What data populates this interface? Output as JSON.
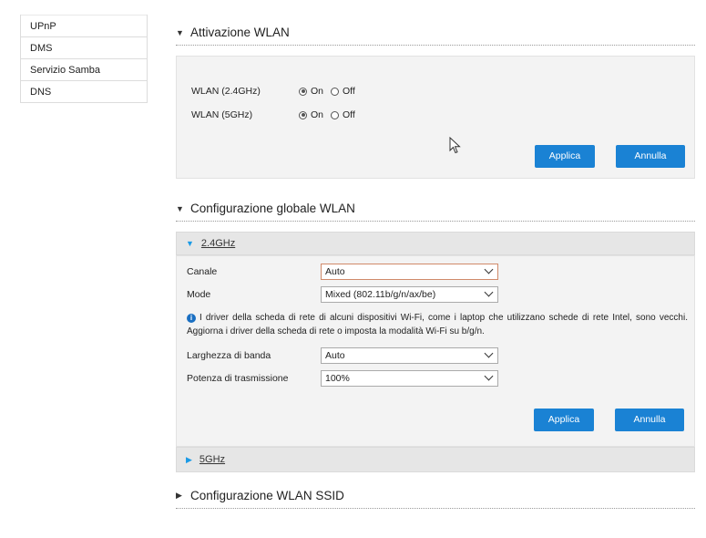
{
  "sidebar": {
    "items": [
      {
        "label": "UPnP"
      },
      {
        "label": "DMS"
      },
      {
        "label": "Servizio Samba"
      },
      {
        "label": "DNS"
      }
    ]
  },
  "wlan_activation": {
    "title": "Attivazione WLAN",
    "rows": [
      {
        "label": "WLAN (2.4GHz)",
        "on_label": "On",
        "off_label": "Off",
        "selected": "On"
      },
      {
        "label": "WLAN (5GHz)",
        "on_label": "On",
        "off_label": "Off",
        "selected": "On"
      }
    ],
    "apply_label": "Applica",
    "cancel_label": "Annulla"
  },
  "global_config": {
    "title": "Configurazione globale WLAN",
    "band_24": {
      "label": "2.4GHz",
      "fields": {
        "canale": {
          "label": "Canale",
          "value": "Auto"
        },
        "mode": {
          "label": "Mode",
          "value": "Mixed (802.11b/g/n/ax/be)"
        },
        "larghezza": {
          "label": "Larghezza di banda",
          "value": "Auto"
        },
        "potenza": {
          "label": "Potenza di trasmissione",
          "value": "100%"
        }
      },
      "note": "I driver della scheda di rete di alcuni dispositivi Wi-Fi, come i laptop che utilizzano schede di rete Intel, sono vecchi. Aggiorna i driver della scheda di rete o imposta la modalità Wi-Fi su b/g/n.",
      "apply_label": "Applica",
      "cancel_label": "Annulla"
    },
    "band_5": {
      "label": "5GHz"
    }
  },
  "ssid_config": {
    "title": "Configurazione WLAN SSID"
  },
  "colors": {
    "primary_button": "#1a82d4",
    "accent_triangle": "#1a9ae6"
  }
}
